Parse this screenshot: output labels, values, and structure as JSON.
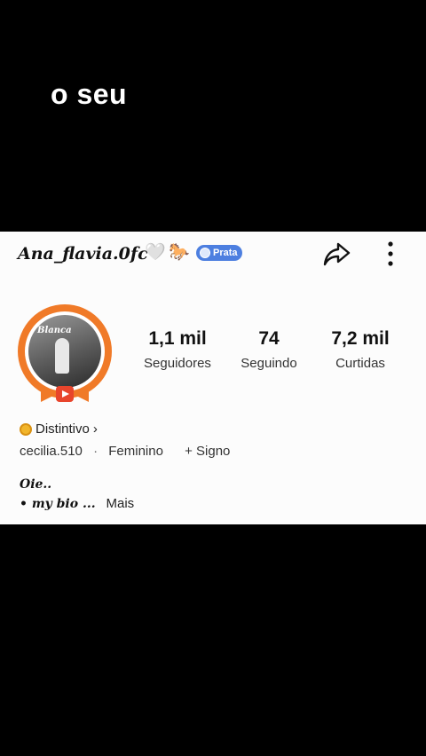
{
  "overlay": {
    "caption": "o seu"
  },
  "header": {
    "username": "Ana_flavia.0fc",
    "emoji_heart": "🤍",
    "emoji_horse": "🐎",
    "badge_label": "Prata",
    "icons": [
      "share-icon",
      "more-vertical-icon"
    ]
  },
  "stats": [
    {
      "value": "1,1 mil",
      "label": "Seguidores"
    },
    {
      "value": "74",
      "label": "Seguindo"
    },
    {
      "value": "7,2 mil",
      "label": "Curtidas"
    }
  ],
  "avatar": {
    "name_overlay": "Blanca"
  },
  "badge_link": {
    "label": "Distintivo",
    "chevron": "›"
  },
  "info": {
    "handle": "cecilia.510",
    "separator": "·",
    "gender": "Feminino",
    "sign": "+ Signo"
  },
  "bio": {
    "line1": "Oie..",
    "line2": "• my bio ...",
    "more": "Mais"
  },
  "colors": {
    "accent_orange": "#f07a28",
    "badge_blue": "#4d7fe0",
    "badge_gold": "#f1b52b"
  }
}
